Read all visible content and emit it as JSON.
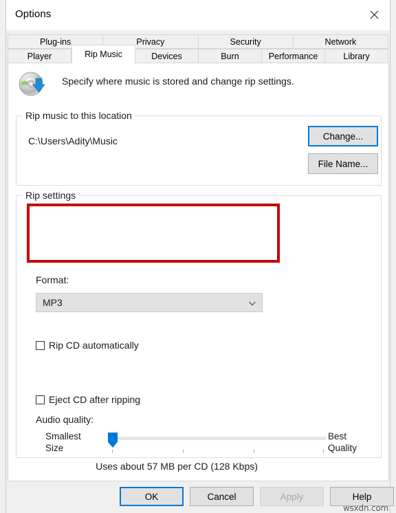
{
  "window": {
    "title": "Options",
    "close_icon": "close-icon"
  },
  "tabs": {
    "row1": [
      {
        "label": "Plug-ins",
        "selected": false
      },
      {
        "label": "Privacy",
        "selected": false
      },
      {
        "label": "Security",
        "selected": false
      },
      {
        "label": "Network",
        "selected": false
      }
    ],
    "row2": [
      {
        "label": "Player",
        "selected": false
      },
      {
        "label": "Rip Music",
        "selected": true
      },
      {
        "label": "Devices",
        "selected": false
      },
      {
        "label": "Burn",
        "selected": false
      },
      {
        "label": "Performance",
        "selected": false
      },
      {
        "label": "Library",
        "selected": false
      }
    ]
  },
  "banner": {
    "icon": "cd-rip-icon",
    "text": "Specify where music is stored and change rip settings."
  },
  "rip_location": {
    "legend": "Rip music to this location",
    "path": "C:\\Users\\Adity\\Music",
    "change_button": "Change...",
    "file_name_button": "File Name..."
  },
  "rip_settings": {
    "legend": "Rip settings",
    "format_label": "Format:",
    "format_value": "MP3",
    "format_options": [
      "MP3"
    ],
    "rip_cd_automatically": {
      "label": "Rip CD automatically",
      "checked": false
    },
    "eject_cd_after_ripping": {
      "label": "Eject CD after ripping",
      "checked": false
    },
    "audio_quality_label": "Audio quality:",
    "slider_min_label_line1": "Smallest",
    "slider_min_label_line2": "Size",
    "slider_max_label_line1": "Best",
    "slider_max_label_line2": "Quality",
    "slider_position_percent": 0,
    "quality_note": "Uses about 57 MB per CD (128 Kbps)"
  },
  "annotation": {
    "color": "#cc0000",
    "target": "format-dropdown"
  },
  "footer": {
    "ok": "OK",
    "cancel": "Cancel",
    "apply": "Apply",
    "help": "Help"
  },
  "watermark": "wsxdn.com"
}
